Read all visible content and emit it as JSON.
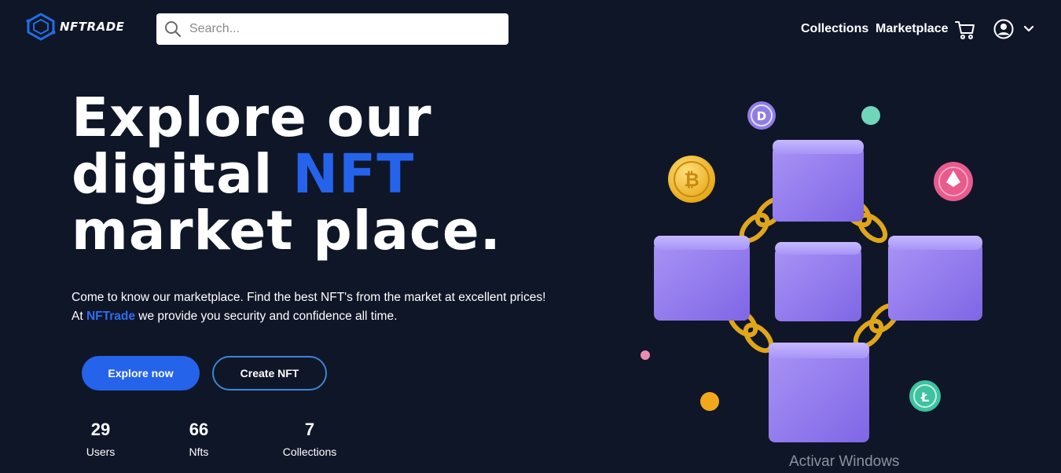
{
  "brand": {
    "name": "NFTRADE",
    "accent_color": "#2563eb"
  },
  "search": {
    "placeholder": "Search..."
  },
  "nav": {
    "collections_label": "Collections",
    "marketplace_label": "Marketplace"
  },
  "hero": {
    "headline_line1": "Explore our",
    "headline_line2_prefix": "digital ",
    "headline_line2_accent": "NFT",
    "headline_line3": "market place.",
    "description_line1": "Come to know our marketplace. Find the best NFT's from the market at excellent prices!",
    "description_line2_prefix": "At ",
    "description_line2_brand": "NFTrade",
    "description_line2_suffix": " we provide you security and confidence all time.",
    "primary_button": "Explore now",
    "secondary_button": "Create NFT"
  },
  "stats": [
    {
      "value": "29",
      "label": "Users"
    },
    {
      "value": "66",
      "label": "Nfts"
    },
    {
      "value": "7",
      "label": "Collections"
    }
  ],
  "icons": [
    "logo-icon",
    "search-icon",
    "cart-icon",
    "user-icon",
    "chevron-down-icon"
  ],
  "overlay": {
    "watermark": "Activar Windows"
  }
}
